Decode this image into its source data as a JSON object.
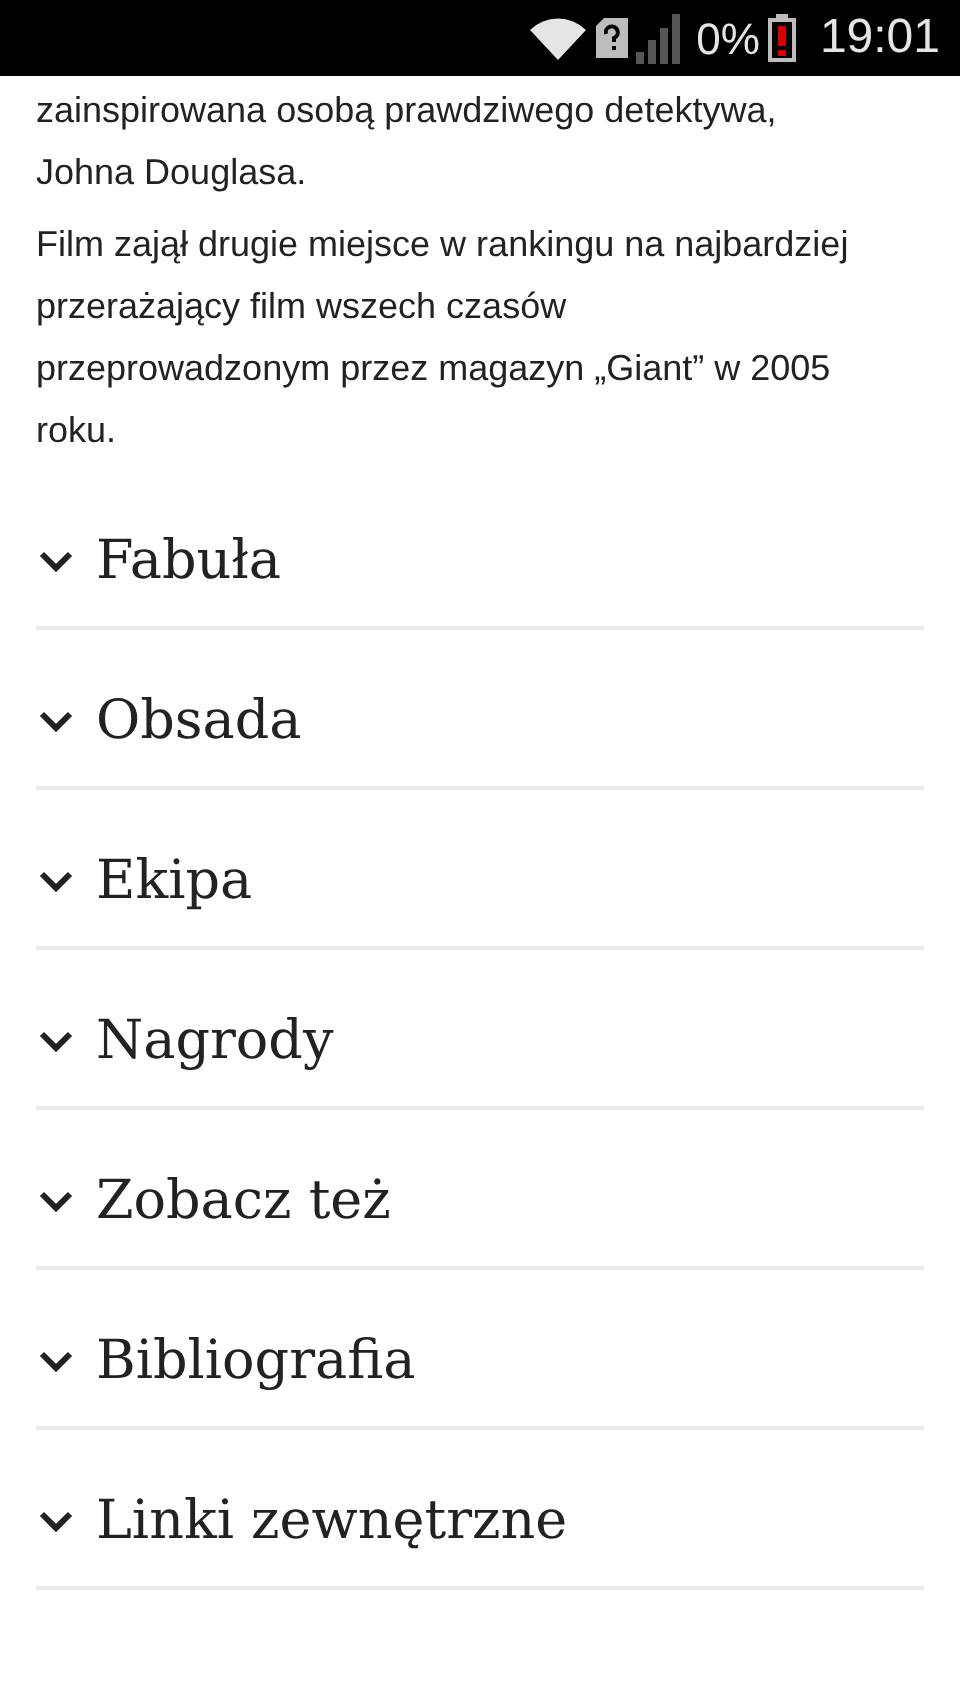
{
  "status_bar": {
    "battery_percent": "0%",
    "time": "19:01"
  },
  "paragraphs": [
    "zainspirowana osobą prawdziwego detektywa, Johna Douglasa.",
    "Film zajął drugie miejsce w rankingu na najbardziej przerażający film wszech czasów przeprowadzonym przez magazyn „Giant” w 2005 roku."
  ],
  "sections": [
    {
      "title": "Fabuła",
      "expanded": false
    },
    {
      "title": "Obsada",
      "expanded": false
    },
    {
      "title": "Ekipa",
      "expanded": false
    },
    {
      "title": "Nagrody",
      "expanded": false
    },
    {
      "title": "Zobacz też",
      "expanded": false
    },
    {
      "title": "Bibliografia",
      "expanded": false
    },
    {
      "title": "Linki zewnętrzne",
      "expanded": false
    }
  ]
}
